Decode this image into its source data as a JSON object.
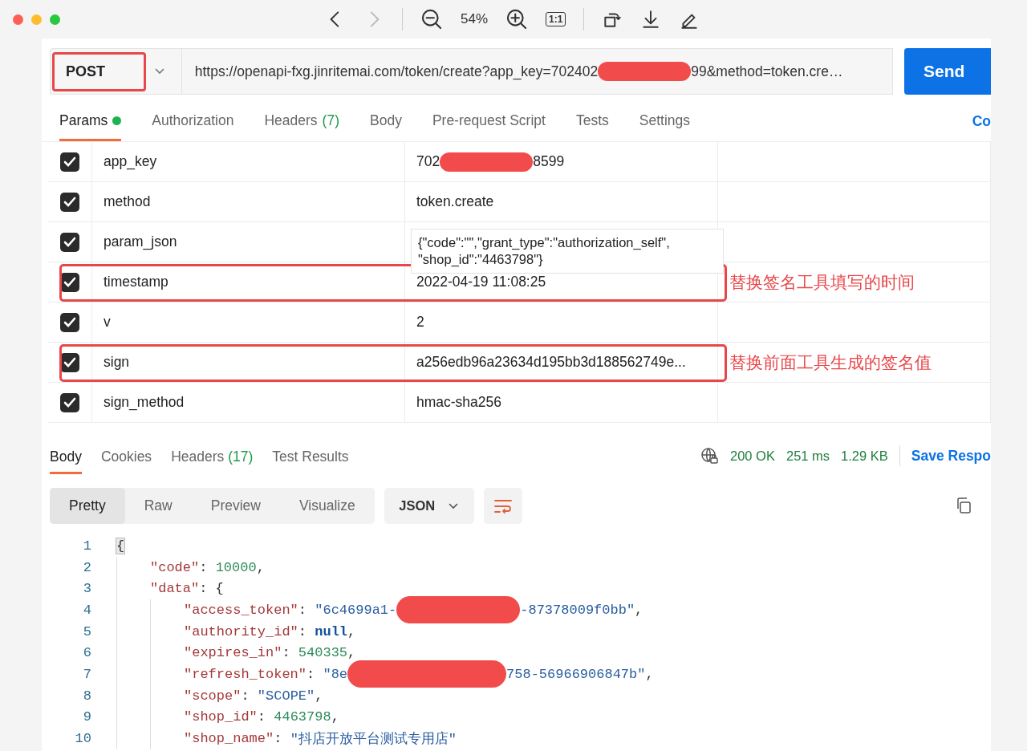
{
  "viewer": {
    "zoom": "54%",
    "actual_size": "1:1",
    "forward_disabled": true
  },
  "request": {
    "method": "POST",
    "method_annotated": true,
    "url_parts": [
      "https://openapi-fxg.jinritemai.com/token/create?app_key=702402",
      "99&method=token.cre…"
    ],
    "send": "Send"
  },
  "request_tabs": [
    {
      "label": "Params",
      "selected": true,
      "dot": true
    },
    {
      "label": "Authorization",
      "selected": false,
      "dot": false
    },
    {
      "label": "Headers",
      "count": "(7)",
      "selected": false,
      "dot": false
    },
    {
      "label": "Body",
      "selected": false,
      "dot": false
    },
    {
      "label": "Pre-request Script",
      "selected": false,
      "dot": false
    },
    {
      "label": "Tests",
      "selected": false,
      "dot": false
    },
    {
      "label": "Settings",
      "selected": false,
      "dot": false
    }
  ],
  "cookies_link": "Co",
  "params": [
    {
      "key": "app_key",
      "kind": "redacted",
      "parts": [
        "702",
        "8599"
      ],
      "checked": true
    },
    {
      "key": "method",
      "kind": "text",
      "value": "token.create",
      "checked": true
    },
    {
      "key": "param_json",
      "kind": "json",
      "lines": [
        "{\"code\":\"\",\"grant_type\":\"authorization_self\",",
        "\"shop_id\":\"4463798\"}"
      ],
      "checked": true
    },
    {
      "key": "timestamp",
      "kind": "text",
      "value": "2022-04-19 11:08:25",
      "checked": true,
      "note": "替换签名工具填写的时间"
    },
    {
      "key": "v",
      "kind": "text",
      "value": "2",
      "checked": true
    },
    {
      "key": "sign",
      "kind": "text",
      "value": "a256edb96a23634d195bb3d188562749e...",
      "checked": true,
      "note": "替换前面工具生成的签名值"
    },
    {
      "key": "sign_method",
      "kind": "text",
      "value": "hmac-sha256",
      "checked": true
    }
  ],
  "response_tabs": [
    {
      "label": "Body",
      "selected": true
    },
    {
      "label": "Cookies",
      "selected": false
    },
    {
      "label": "Headers",
      "count": "(17)",
      "selected": false
    },
    {
      "label": "Test Results",
      "selected": false
    }
  ],
  "status": "200 OK",
  "time": "251 ms",
  "size": "1.29 KB",
  "save": "Save Respo",
  "view_modes": [
    {
      "label": "Pretty",
      "selected": true
    },
    {
      "label": "Raw",
      "selected": false
    },
    {
      "label": "Preview",
      "selected": false
    },
    {
      "label": "Visualize",
      "selected": false
    }
  ],
  "format": "JSON",
  "code": [
    {
      "number": "1",
      "tokens": [
        {
          "kind": "punct",
          "text": "{",
          "highlighted": true
        }
      ],
      "children": [
        {
          "number": "2",
          "tokens": [
            {
              "kind": "key",
              "text": "\"code\""
            },
            {
              "kind": "punct",
              "text": ": "
            },
            {
              "kind": "number",
              "text": "10000"
            },
            {
              "kind": "punct",
              "text": ","
            }
          ]
        },
        {
          "number": "3",
          "tokens": [
            {
              "kind": "key",
              "text": "\"data\""
            },
            {
              "kind": "punct",
              "text": ": {"
            }
          ],
          "children": [
            {
              "number": "4",
              "tokens": [
                {
                  "kind": "key",
                  "text": "\"access_token\""
                },
                {
                  "kind": "punct",
                  "text": ": "
                },
                {
                  "kind": "string",
                  "text": "\"6c4699a1-"
                },
                {
                  "kind": "redacted"
                },
                {
                  "kind": "string",
                  "text": "-87378009f0bb\""
                },
                {
                  "kind": "punct",
                  "text": ","
                }
              ]
            },
            {
              "number": "5",
              "tokens": [
                {
                  "kind": "key",
                  "text": "\"authority_id\""
                },
                {
                  "kind": "punct",
                  "text": ": "
                },
                {
                  "kind": "null",
                  "text": "null"
                },
                {
                  "kind": "punct",
                  "text": ","
                }
              ]
            },
            {
              "number": "6",
              "tokens": [
                {
                  "kind": "key",
                  "text": "\"expires_in\""
                },
                {
                  "kind": "punct",
                  "text": ": "
                },
                {
                  "kind": "number",
                  "text": "540335"
                },
                {
                  "kind": "punct",
                  "text": ","
                }
              ]
            },
            {
              "number": "7",
              "tokens": [
                {
                  "kind": "key",
                  "text": "\"refresh_token\""
                },
                {
                  "kind": "punct",
                  "text": ": "
                },
                {
                  "kind": "string",
                  "text": "\"8e"
                },
                {
                  "kind": "redacted"
                },
                {
                  "kind": "string",
                  "text": "758-56966906847b\""
                },
                {
                  "kind": "punct",
                  "text": ","
                }
              ]
            },
            {
              "number": "8",
              "tokens": [
                {
                  "kind": "key",
                  "text": "\"scope\""
                },
                {
                  "kind": "punct",
                  "text": ": "
                },
                {
                  "kind": "string",
                  "text": "\"SCOPE\""
                },
                {
                  "kind": "punct",
                  "text": ","
                }
              ]
            },
            {
              "number": "9",
              "tokens": [
                {
                  "kind": "key",
                  "text": "\"shop_id\""
                },
                {
                  "kind": "punct",
                  "text": ": "
                },
                {
                  "kind": "number",
                  "text": "4463798"
                },
                {
                  "kind": "punct",
                  "text": ","
                }
              ]
            },
            {
              "number": "10",
              "tokens": [
                {
                  "kind": "key",
                  "text": "\"shop_name\""
                },
                {
                  "kind": "punct",
                  "text": ": "
                },
                {
                  "kind": "string",
                  "text": "\"抖店开放平台测试专用店\""
                }
              ]
            }
          ]
        }
      ]
    }
  ]
}
